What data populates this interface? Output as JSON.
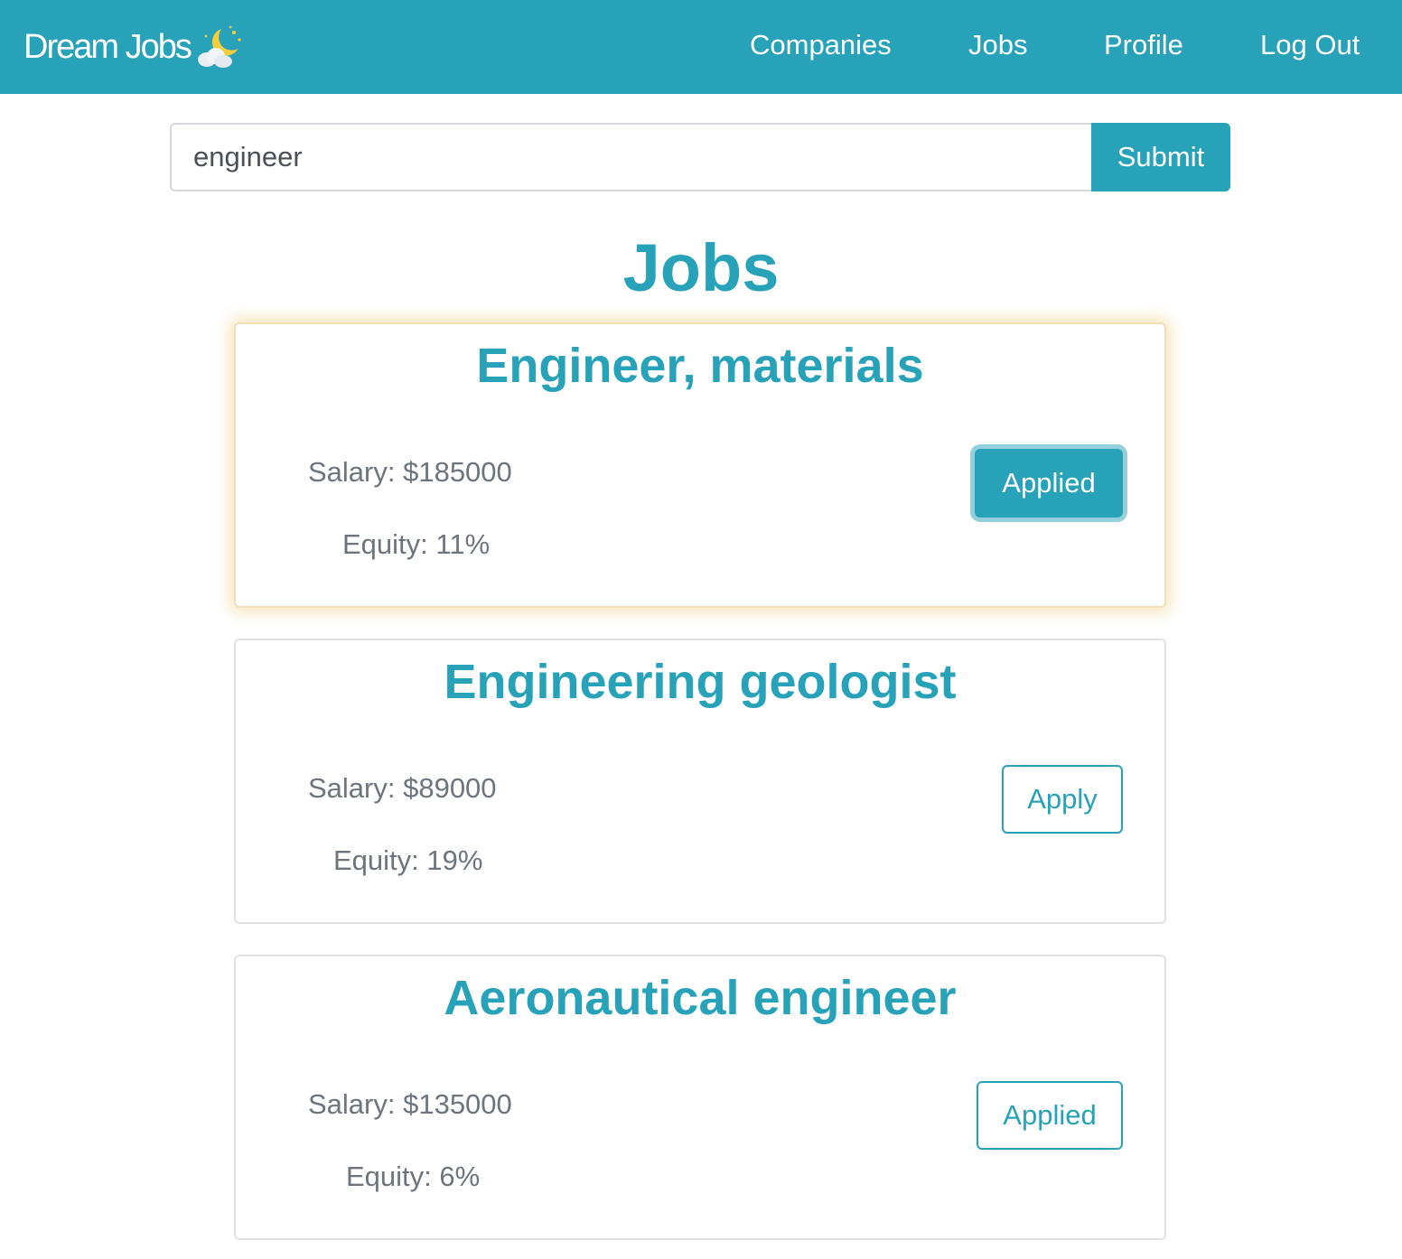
{
  "navbar": {
    "brand": "Dream Jobs",
    "brand_icon": "moon-cloud-icon",
    "links": [
      {
        "label": "Companies"
      },
      {
        "label": "Jobs"
      },
      {
        "label": "Profile"
      },
      {
        "label": "Log Out"
      }
    ]
  },
  "search": {
    "value": "engineer",
    "submit_label": "Submit"
  },
  "main": {
    "title": "Jobs",
    "jobs": [
      {
        "title": "Engineer, materials",
        "salary": "Salary: $185000",
        "equity": "Equity: 11%",
        "button": "Applied",
        "button_state": "focused-solid"
      },
      {
        "title": "Engineering geologist",
        "salary": "Salary: $89000",
        "equity": "Equity: 19%",
        "button": "Apply",
        "button_state": "outline"
      },
      {
        "title": "Aeronautical engineer",
        "salary": "Salary: $135000",
        "equity": "Equity: 6%",
        "button": "Applied",
        "button_state": "outline"
      }
    ]
  },
  "colors": {
    "primary": "#27a2b8",
    "muted_text": "#6c757d",
    "highlight_glow": "#f0c878"
  }
}
